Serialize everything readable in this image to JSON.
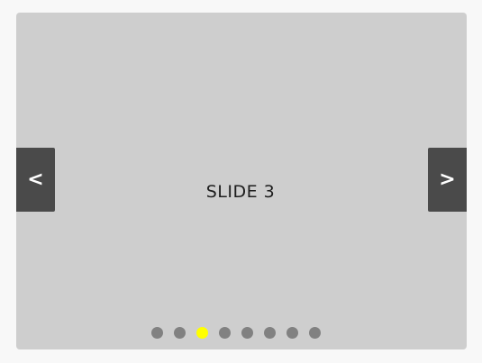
{
  "carousel": {
    "current_slide_label": "SLIDE 3",
    "prev_label": "<",
    "next_label": ">",
    "active_index": 2,
    "dot_count": 8,
    "colors": {
      "slide_background": "#cecece",
      "nav_background": "#4a4a4a",
      "dot_inactive": "#818181",
      "dot_active": "#ffff00"
    },
    "dots": [
      {
        "index": 1,
        "active": false
      },
      {
        "index": 2,
        "active": false
      },
      {
        "index": 3,
        "active": true
      },
      {
        "index": 4,
        "active": false
      },
      {
        "index": 5,
        "active": false
      },
      {
        "index": 6,
        "active": false
      },
      {
        "index": 7,
        "active": false
      },
      {
        "index": 8,
        "active": false
      }
    ]
  }
}
